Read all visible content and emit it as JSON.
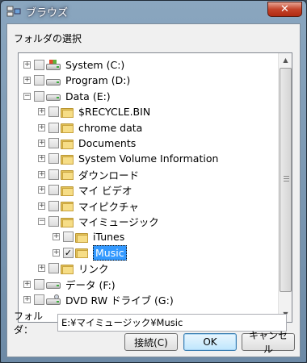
{
  "window": {
    "title": "ブラウズ",
    "close_glyph": "✕"
  },
  "dialog": {
    "instruction": "フォルダの選択",
    "folder_label": "フォルダ：",
    "folder_value": "E:¥マイミュージック¥Music",
    "buttons": {
      "connect": "接続(C)",
      "ok": "OK",
      "cancel": "キャンセル"
    }
  },
  "tree": {
    "items": [
      {
        "label": "System (C:)",
        "icon": "windows-drive-icon",
        "level": 0,
        "expander": "+",
        "checked": false
      },
      {
        "label": "Program (D:)",
        "icon": "drive-icon",
        "level": 0,
        "expander": "+",
        "checked": false
      },
      {
        "label": "Data (E:)",
        "icon": "drive-icon",
        "level": 0,
        "expander": "−",
        "checked": false
      },
      {
        "label": "$RECYCLE.BIN",
        "icon": "folder-icon",
        "level": 1,
        "expander": "+",
        "checked": false
      },
      {
        "label": "chrome data",
        "icon": "folder-icon",
        "level": 1,
        "expander": "+",
        "checked": false
      },
      {
        "label": "Documents",
        "icon": "folder-icon",
        "level": 1,
        "expander": "+",
        "checked": false
      },
      {
        "label": "System Volume Information",
        "icon": "folder-icon",
        "level": 1,
        "expander": "+",
        "checked": false
      },
      {
        "label": "ダウンロード",
        "icon": "folder-icon",
        "level": 1,
        "expander": "+",
        "checked": false
      },
      {
        "label": "マイ ビデオ",
        "icon": "folder-icon",
        "level": 1,
        "expander": "+",
        "checked": false
      },
      {
        "label": "マイピクチャ",
        "icon": "folder-icon",
        "level": 1,
        "expander": "+",
        "checked": false
      },
      {
        "label": "マイミュージック",
        "icon": "folder-icon",
        "level": 1,
        "expander": "−",
        "checked": false
      },
      {
        "label": "iTunes",
        "icon": "folder-icon",
        "level": 2,
        "expander": "+",
        "checked": false
      },
      {
        "label": "Music",
        "icon": "folder-icon",
        "level": 2,
        "expander": "+",
        "checked": true,
        "selected": true
      },
      {
        "label": "リンク",
        "icon": "folder-icon",
        "level": 1,
        "expander": "+",
        "checked": false
      },
      {
        "label": "データ (F:)",
        "icon": "drive-icon",
        "level": 0,
        "expander": "+",
        "checked": false
      },
      {
        "label": "DVD RW ドライブ (G:)",
        "icon": "dvd-drive-icon",
        "level": 0,
        "expander": "+",
        "checked": false
      }
    ]
  },
  "colors": {
    "selection": "#3399ff",
    "title_bar": "#7a96b0",
    "close_button": "#c5442b"
  }
}
